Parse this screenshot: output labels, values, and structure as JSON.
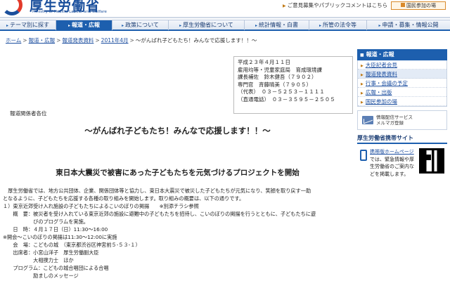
{
  "header": {
    "logo_ja": "厚生労働省",
    "logo_en": "Ministry of Health, Labour and Welfare",
    "opinion_link": "ご意見募集やパブリックコメントはこちら",
    "kokumin_button": "国民参加の場"
  },
  "nav": {
    "items": [
      {
        "label": "テーマ別に探す",
        "active": false
      },
      {
        "label": "報道・広報",
        "active": true
      },
      {
        "label": "政策について",
        "active": false
      },
      {
        "label": "厚生労働省について",
        "active": false
      },
      {
        "label": "統計情報・白書",
        "active": false
      },
      {
        "label": "所管の法令等",
        "active": false
      },
      {
        "label": "申請・募集・情報公開",
        "active": false
      }
    ]
  },
  "breadcrumb": {
    "items": [
      "ホーム",
      "報道・広報",
      "報道発表資料",
      "2011年4月"
    ],
    "current": "～がんばれ子どもたち！みんなで応援します！！～",
    "separator": ">"
  },
  "contact": {
    "lines": [
      "平成２３年４月１１日",
      "雇用均等・児童家庭局　育成環境課",
      "課長補佐　鈴木健吾（７９０２）",
      "専門官　斉藤晴美（７９０５）",
      "（代表）　０３－５２５３－１１１１",
      "（直通電話）　０３－３５９５－２５０５"
    ]
  },
  "main": {
    "addressee": "報道関係者各位",
    "title": "～がんばれ子どもたち！みんなで応援します！！～",
    "subtitle": "東日本大震災で被害にあった子どもたちを元気づけるプロジェクトを開始",
    "body_lines": [
      "　厚生労働省では、地方公共団体、企業、関係団体等と協力し、東日本大震災で被災した子どもたちが元気になり、笑顔を取り戻す一助",
      "となるように、子どもたちを応援する各種の取り組みを開始します。取り組みの概要は、以下の通りです。",
      "",
      "１）東京近郊受け入れ施設の子どもたちによるこいのぼりの掲揚　　※別添チラシ参照",
      "　　概　要：被災者を受け入れている東京近郊の施設に避難中の子どもたちを招待し、こいのぼりの掲揚を行うとともに、子どもたちに遊",
      "　　　　　　びのプログラムを実施。",
      "　　日　時：４月１７日（日）11:30～16:00",
      "※開会～こいのぼりの掲揚は11:30～12:00に実施",
      "　　会　場：こどもの城　（東京都渋谷区神宮前５-５３-１）",
      "　　出席者：小宮山洋子　厚生労働副大臣",
      "　　　　　　大相撲力士　ほか",
      "　　プログラム：こどもの城合唱団による合唱",
      "　　　　　　励ましのメッセージ"
    ]
  },
  "sidebar": {
    "heading": "報道・広報",
    "items": [
      {
        "label": "大臣記者会見",
        "current": false
      },
      {
        "label": "報道発表資料",
        "current": true
      },
      {
        "label": "行事・会議の予定",
        "current": false
      },
      {
        "label": "広報・出版",
        "current": false
      },
      {
        "label": "国民参加の場",
        "current": false
      }
    ],
    "mail_line1": "情報配信サービス",
    "mail_line2": "メルマガ登録",
    "mobile_heading": "厚生労働省携帯サイト",
    "mobile_link": "携帯版ホームページ",
    "mobile_text": "では、緊急情報や厚生労働省のご案内などを掲載します。"
  },
  "colors": {
    "brand_blue": "#1d5fae",
    "accent_orange": "#d98a2b",
    "logo_red": "#e23a2a"
  }
}
